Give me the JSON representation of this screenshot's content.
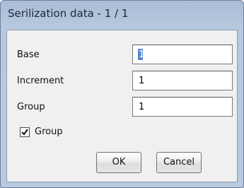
{
  "window": {
    "title": "Serilization data - 1 / 1"
  },
  "fields": [
    {
      "label": "Base",
      "value": "1"
    },
    {
      "label": "Increment",
      "value": "1"
    },
    {
      "label": "Group",
      "value": "1"
    }
  ],
  "group_checkbox": {
    "label": "Group",
    "checked": true
  },
  "buttons": {
    "ok_label": "OK",
    "cancel_label": "Cancel"
  },
  "colors": {
    "title_bar": "#a9bdd6",
    "client_background": "#f0f0f0",
    "selection": "#3a72c8"
  }
}
